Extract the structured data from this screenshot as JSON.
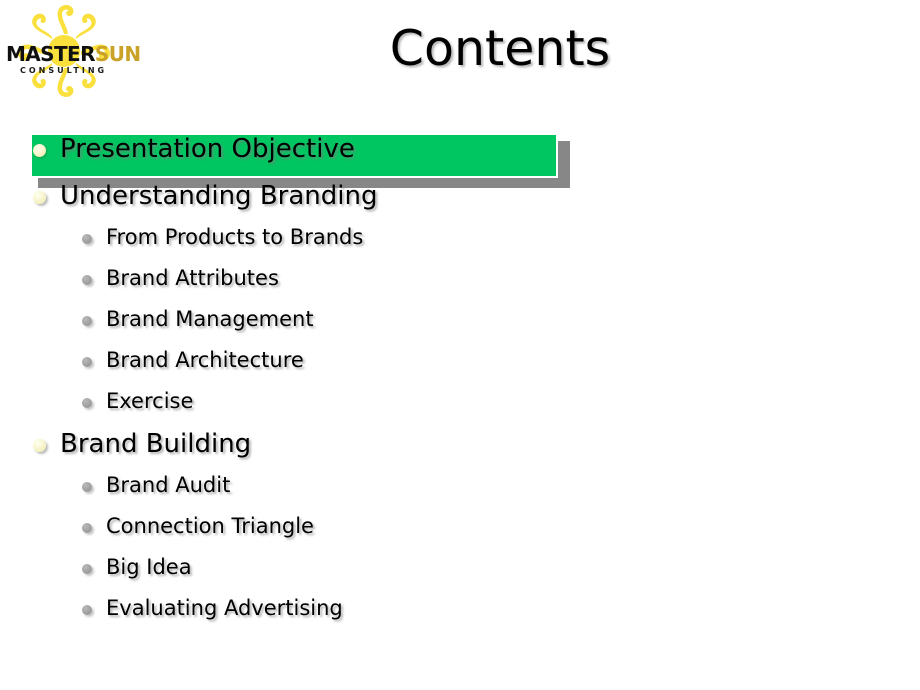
{
  "slide": {
    "background_color": "#FFFFFF",
    "title": "Contents"
  },
  "logo": {
    "name": "mastersun-consulting-logo",
    "word_master": "MASTER",
    "word_sun": "SUN",
    "word_consulting": "CONSULTING",
    "sun_color": "#FAE03C",
    "master_color": "#101010",
    "sun_text_color": "#C9A227"
  },
  "colors": {
    "highlight_green": "#00C661",
    "highlight_shadow": "#878787",
    "bullet_level1": "#F7F4C8",
    "bullet_level2": "#9E9E9E",
    "text": "#000000"
  },
  "content": {
    "items": [
      {
        "label": "Presentation  Objective",
        "level": 1,
        "highlighted": true,
        "bullet": "bullet-circle-cream"
      },
      {
        "label": "Understanding Branding",
        "level": 1,
        "highlighted": false,
        "bullet": "bullet-circle-cream"
      },
      {
        "label": "From Products to Brands",
        "level": 2,
        "highlighted": false,
        "bullet": "bullet-circle-gray"
      },
      {
        "label": "Brand Attributes",
        "level": 2,
        "highlighted": false,
        "bullet": "bullet-circle-gray"
      },
      {
        "label": "Brand Management",
        "level": 2,
        "highlighted": false,
        "bullet": "bullet-circle-gray"
      },
      {
        "label": "Brand Architecture",
        "level": 2,
        "highlighted": false,
        "bullet": "bullet-circle-gray"
      },
      {
        "label": "Exercise",
        "level": 2,
        "highlighted": false,
        "bullet": "bullet-circle-gray"
      },
      {
        "label": "Brand Building",
        "level": 1,
        "highlighted": false,
        "bullet": "bullet-circle-cream"
      },
      {
        "label": "Brand Audit",
        "level": 2,
        "highlighted": false,
        "bullet": "bullet-circle-gray"
      },
      {
        "label": "Connection Triangle",
        "level": 2,
        "highlighted": false,
        "bullet": "bullet-circle-gray"
      },
      {
        "label": "Big Idea",
        "level": 2,
        "highlighted": false,
        "bullet": "bullet-circle-gray"
      },
      {
        "label": "Evaluating Advertising",
        "level": 2,
        "highlighted": false,
        "bullet": "bullet-circle-gray"
      }
    ]
  }
}
